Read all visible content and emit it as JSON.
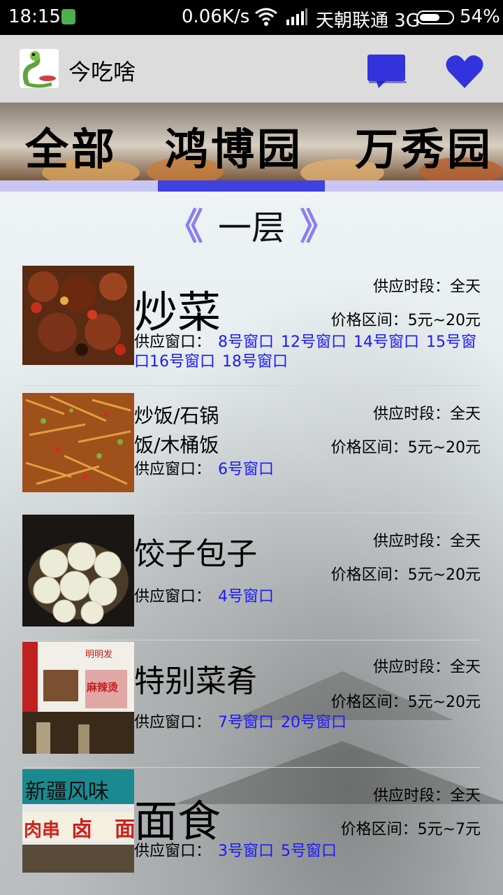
{
  "status_bar": {
    "time": "18:15",
    "net_speed": "0.06K/s",
    "carrier": "天朝联通 3G",
    "battery": "54%"
  },
  "app": {
    "title": "今吃啥",
    "logo_icon": "snake-chef-logo",
    "actions": [
      "chat-icon",
      "heart-icon"
    ],
    "accent_color": "#3333dd"
  },
  "banner": {
    "tabs": [
      "全部",
      "鸿博园",
      "万秀园"
    ]
  },
  "floor": {
    "prev": "《",
    "name": "一层",
    "next": "》"
  },
  "labels": {
    "time": "供应时段：全天",
    "window_prefix": "供应窗口："
  },
  "items": [
    {
      "name": "炒菜",
      "price": "价格区间：5元~20元",
      "windows": [
        "8号窗口",
        "12号窗口",
        "14号窗口",
        "15号窗口",
        "16号窗口",
        "18号窗口"
      ]
    },
    {
      "name": "炒饭/石锅饭/木桶饭",
      "price": "价格区间：5元~20元",
      "windows": [
        "6号窗口"
      ]
    },
    {
      "name": "饺子包子",
      "price": "价格区间：5元~20元",
      "windows": [
        "4号窗口"
      ]
    },
    {
      "name": "特别菜肴",
      "price": "价格区间：5元~20元",
      "windows": [
        "7号窗口",
        "20号窗口"
      ]
    },
    {
      "name": "面食",
      "price": "价格区间：5元~7元",
      "windows": [
        "3号窗口",
        "5号窗口"
      ]
    }
  ],
  "item4_sign": {
    "line1": "明明发",
    "line2": "麻辣烫"
  },
  "item5_sign": {
    "line1": "新疆风味",
    "line2": "肉串",
    "line3": "卤",
    "line4": "面"
  }
}
